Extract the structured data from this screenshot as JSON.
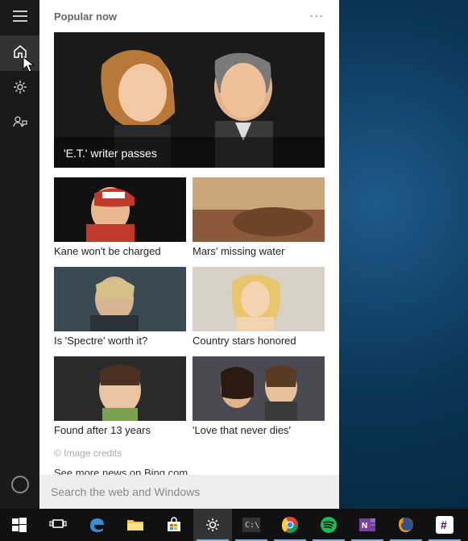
{
  "sidebar": {
    "items": [
      {
        "name": "menu"
      },
      {
        "name": "home",
        "selected": true
      },
      {
        "name": "settings"
      },
      {
        "name": "feedback"
      }
    ],
    "cortana": "cortana-ring"
  },
  "panel": {
    "header": "Popular now",
    "more": "···",
    "featured": {
      "label": "'E.T.' writer passes"
    },
    "tiles": [
      {
        "label": "Kane won't be charged"
      },
      {
        "label": "Mars' missing water"
      },
      {
        "label": "Is 'Spectre' worth it?"
      },
      {
        "label": "Country stars honored"
      },
      {
        "label": "Found after 13 years"
      },
      {
        "label": "'Love that never dies'"
      }
    ],
    "credits": "© Image credits",
    "seemore": "See more news on Bing.com",
    "search_placeholder": "Search the web and Windows"
  },
  "taskbar": {
    "items": [
      {
        "name": "start",
        "active": false
      },
      {
        "name": "taskview",
        "active": false
      },
      {
        "name": "edge",
        "active": false
      },
      {
        "name": "fileexplorer",
        "active": false
      },
      {
        "name": "store",
        "active": false
      },
      {
        "name": "settings-app",
        "active": true,
        "highlight": true
      },
      {
        "name": "console",
        "active": true
      },
      {
        "name": "chrome",
        "active": true
      },
      {
        "name": "spotify",
        "active": true
      },
      {
        "name": "onenote",
        "active": true
      },
      {
        "name": "firefox",
        "active": true
      },
      {
        "name": "slack",
        "active": true
      }
    ]
  },
  "colors": {
    "taskbar_bg": "#111111",
    "panel_bg": "#ffffff",
    "sidebar_bg": "#1a1a1a",
    "accent": "#76b9ed"
  }
}
